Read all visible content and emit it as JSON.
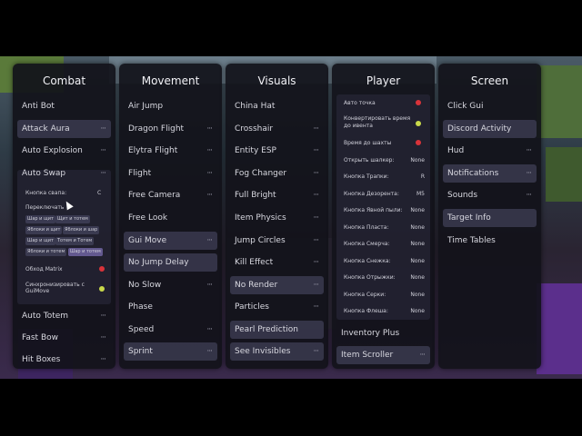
{
  "combat": {
    "title": "Combat",
    "items": [
      "Anti Bot",
      "Attack Aura",
      "Auto Explosion",
      "Auto Swap",
      "Auto Totem",
      "Fast Bow",
      "Hit Boxes"
    ],
    "swap_key_label": "Кнопка свапа:",
    "swap_key_value": "C",
    "toggle_label": "Переключать",
    "chips": [
      "Шар и щит",
      "Щит и тотем",
      "Яблоки и щит",
      "Яблоки и шар",
      "Шар и щит",
      "Тотем и Тотем",
      "Яблоки и тотем",
      "Шар и тотем"
    ],
    "bypass_label": "Обход Matrix",
    "sync_label": "Синхронизировать с GuiMove"
  },
  "movement": {
    "title": "Movement",
    "items": [
      "Air Jump",
      "Dragon Flight",
      "Elytra Flight",
      "Flight",
      "Free Camera",
      "Free Look",
      "Gui Move",
      "No Jump Delay",
      "No Slow",
      "Phase",
      "Speed",
      "Sprint"
    ]
  },
  "visuals": {
    "title": "Visuals",
    "items": [
      "China Hat",
      "Crosshair",
      "Entity ESP",
      "Fog Changer",
      "Full Bright",
      "Item Physics",
      "Jump Circles",
      "Kill Effect",
      "No Render",
      "Particles",
      "Pearl Prediction",
      "See Invisibles"
    ]
  },
  "player": {
    "title": "Player",
    "settings": [
      {
        "label": "Авто точка",
        "value": ""
      },
      {
        "label": "Конвертировать время до ивента",
        "value": ""
      },
      {
        "label": "Время до шахты",
        "value": ""
      },
      {
        "label": "Открыть шалкер:",
        "value": "None"
      },
      {
        "label": "Кнопка Трапки:",
        "value": "R"
      },
      {
        "label": "Кнопка Дезорента:",
        "value": "M5"
      },
      {
        "label": "Кнопка Явной пыли:",
        "value": "None"
      },
      {
        "label": "Кнопка Пласта:",
        "value": "None"
      },
      {
        "label": "Кнопка Смерча:",
        "value": "None"
      },
      {
        "label": "Кнопка Снежка:",
        "value": "None"
      },
      {
        "label": "Кнопка Отрыжки:",
        "value": "None"
      },
      {
        "label": "Кнопка Серки:",
        "value": "None"
      },
      {
        "label": "Кнопка Флеша:",
        "value": "None"
      }
    ],
    "items": [
      "Inventory Plus",
      "Item Scroller"
    ]
  },
  "screen": {
    "title": "Screen",
    "items": [
      "Click Gui",
      "Discord Activity",
      "Hud",
      "Notifications",
      "Sounds",
      "Target Info",
      "Time Tables"
    ]
  },
  "dots": "···",
  "colors": {
    "panel_bg": "#12121a",
    "highlight": "#3c3c52",
    "red": "#d9333a",
    "green": "#c9d94a"
  }
}
